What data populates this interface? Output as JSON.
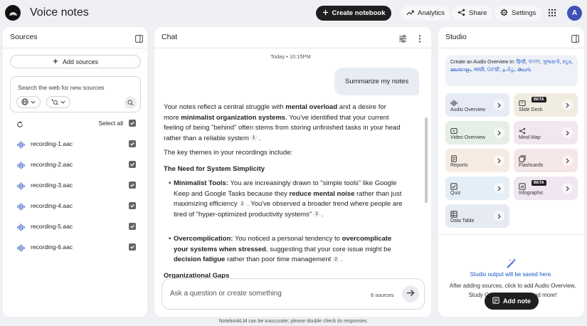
{
  "app": {
    "title": "Voice notes",
    "logo_icon": "notebooklm-logo-icon"
  },
  "topbar": {
    "create_label": "Create notebook",
    "analytics_label": "Analytics",
    "share_label": "Share",
    "settings_label": "Settings",
    "avatar_letter": "A"
  },
  "sources": {
    "title": "Sources",
    "add_label": "Add sources",
    "search_placeholder": "Search the web for new sources",
    "select_all_label": "Select all",
    "items": [
      {
        "name": "recording-1.aac",
        "checked": true
      },
      {
        "name": "recording-2.aac",
        "checked": true
      },
      {
        "name": "recording-3.aac",
        "checked": true
      },
      {
        "name": "recording-4.aac",
        "checked": true
      },
      {
        "name": "recording-5.aac",
        "checked": true
      },
      {
        "name": "recording-6.aac",
        "checked": true
      }
    ]
  },
  "chat": {
    "title": "Chat",
    "timestamp": "Today • 10:15PM",
    "user_message": "Summarize my notes",
    "intro": {
      "t1": "Your notes reflect a central struggle with ",
      "b1": "mental overload",
      "t2": " and a desire for more ",
      "b2": "minimalist organization systems",
      "t3": ". You've identified that your current feeling of being \"behind\" often stems from storing unfinished tasks in your head rather than a reliable system",
      "c1": "1",
      "t4": "."
    },
    "themes_line": "The key themes in your recordings include:",
    "section_heading": "The Need for System Simplicity",
    "bullet1": {
      "b1": "Minimalist Tools:",
      "t1": " You are increasingly drawn to \"simple tools\" like Google Keep and Google Tasks because they ",
      "b2": "reduce mental noise",
      "t2": " rather than just maximizing efficiency",
      "c1": "2",
      "t3": ". You've observed a broader trend where people are tired of \"hyper-optimized productivity systems\"",
      "c2": "1",
      "t4": "."
    },
    "bullet2": {
      "b1": "Overcomplication:",
      "t1": " You noticed a personal tendency to ",
      "b2": "overcomplicate your systems when stressed",
      "t2": ", suggesting that your core issue might be ",
      "b3": "decision fatigue",
      "t3": " rather than poor time management",
      "c1": "2",
      "t4": "."
    },
    "next_heading": "Organizational Gaps",
    "input_placeholder": "Ask a question or create something",
    "source_count": "6 sources"
  },
  "studio": {
    "title": "Studio",
    "overview_prefix": "Create an Audio Overview in:",
    "languages": [
      "हिन्दी",
      "বাংলা",
      "ગુજરાતી",
      "ಕನ್ನಡ",
      "മലയാളം",
      "मराठी",
      "ਪੰਜਾਬੀ",
      "தமிழ்",
      "తెలుగు"
    ],
    "tiles": [
      {
        "label": "Audio Overview",
        "icon": "audio-waveform-icon",
        "color": "#e6ebf7"
      },
      {
        "label": "Slide Deck",
        "icon": "slides-icon",
        "color": "#f1ece0",
        "beta": "BETA"
      },
      {
        "label": "Video Overview",
        "icon": "video-icon",
        "color": "#e6efe6"
      },
      {
        "label": "Mind Map",
        "icon": "mind-map-icon",
        "color": "#f2e6ef"
      },
      {
        "label": "Reports",
        "icon": "reports-icon",
        "color": "#f5ebe3"
      },
      {
        "label": "Flashcards",
        "icon": "flashcards-icon",
        "color": "#f5e6e8"
      },
      {
        "label": "Quiz",
        "icon": "quiz-icon",
        "color": "#e3eef6"
      },
      {
        "label": "Infographic",
        "icon": "infographic-icon",
        "color": "#f0e6f2",
        "beta": "BETA"
      },
      {
        "label": "Data Table",
        "icon": "table-icon",
        "color": "#e6eaf3"
      }
    ],
    "saved_title": "Studio output will be saved here.",
    "saved_desc": "After adding sources, click to add Audio Overview, Study Guide, Mind Map, and more!",
    "add_note_label": "Add note"
  },
  "footer": "NotebookLM can be inaccurate; please double check its responses."
}
